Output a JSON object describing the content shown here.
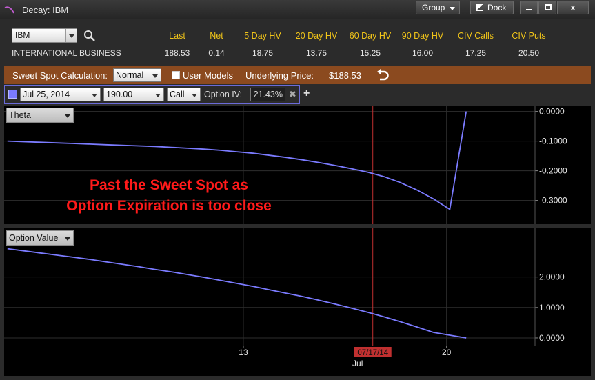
{
  "window": {
    "title": "Decay: IBM"
  },
  "toolbar": {
    "group_label": "Group",
    "dock_label": "Dock",
    "close_glyph": "x"
  },
  "quote": {
    "symbol": "IBM",
    "company": "INTERNATIONAL BUSINESS",
    "columns": [
      {
        "header": "Last",
        "value": "188.53"
      },
      {
        "header": "Net",
        "value": "0.14"
      },
      {
        "header": "5 Day HV",
        "value": "18.75"
      },
      {
        "header": "20 Day HV",
        "value": "13.75"
      },
      {
        "header": "60 Day HV",
        "value": "15.25"
      },
      {
        "header": "90 Day HV",
        "value": "16.00"
      },
      {
        "header": "CIV Calls",
        "value": "17.25"
      },
      {
        "header": "CIV Puts",
        "value": "20.50"
      }
    ]
  },
  "sweet_spot": {
    "label": "Sweet Spot Calculation:",
    "mode": "Normal",
    "user_models_label": "User Models",
    "underlying_label": "Underlying Price:",
    "underlying_value": "$188.53"
  },
  "option": {
    "expiration": "Jul 25, 2014",
    "strike": "190.00",
    "type": "Call",
    "iv_label": "Option IV:",
    "iv_value": "21.43%",
    "clear_glyph": "✖",
    "add_glyph": "+"
  },
  "annotation": [
    "Past the Sweet Spot as",
    "Option Expiration is too close"
  ],
  "colors": {
    "series": "#7b7bff",
    "marker": "#c03030",
    "annotation": "#ff1a1a",
    "sweet_bar": "#8b4a1f",
    "quote_header": "#f0c419"
  },
  "chart_data": [
    {
      "type": "line",
      "selector": "Theta",
      "ytick_labels": [
        "0.0000",
        "-0.1000",
        "-0.2000",
        "-0.3000"
      ],
      "ylim": [
        -0.38,
        0.02
      ],
      "x": [
        0,
        0.5,
        1,
        1.5,
        2,
        2.5,
        3,
        3.5,
        4,
        4.5,
        5,
        5.5,
        6,
        6.5,
        7,
        7.5,
        8,
        8.5,
        9,
        9.5,
        10,
        10.5,
        11,
        11.5,
        12,
        12.5,
        13,
        13.5,
        14
      ],
      "values": [
        -0.1,
        -0.102,
        -0.104,
        -0.106,
        -0.108,
        -0.11,
        -0.112,
        -0.114,
        -0.116,
        -0.118,
        -0.121,
        -0.124,
        -0.127,
        -0.131,
        -0.136,
        -0.141,
        -0.148,
        -0.155,
        -0.163,
        -0.172,
        -0.182,
        -0.193,
        -0.205,
        -0.22,
        -0.24,
        -0.265,
        -0.295,
        -0.33,
        0.0
      ]
    },
    {
      "type": "line",
      "selector": "Option Value",
      "ytick_labels": [
        "2.0000",
        "1.0000",
        "0.0000"
      ],
      "ylim": [
        -0.25,
        3.6
      ],
      "x": [
        0,
        0.5,
        1,
        1.5,
        2,
        2.5,
        3,
        3.5,
        4,
        4.5,
        5,
        5.5,
        6,
        6.5,
        7,
        7.5,
        8,
        8.5,
        9,
        9.5,
        10,
        10.5,
        11,
        11.5,
        12,
        12.5,
        13,
        13.5,
        14
      ],
      "values": [
        2.93,
        2.86,
        2.79,
        2.72,
        2.65,
        2.58,
        2.5,
        2.42,
        2.34,
        2.25,
        2.17,
        2.08,
        1.99,
        1.89,
        1.79,
        1.69,
        1.58,
        1.47,
        1.36,
        1.24,
        1.11,
        0.98,
        0.84,
        0.69,
        0.53,
        0.36,
        0.18,
        0.09,
        0.0
      ]
    }
  ],
  "x_axis": {
    "ticks": [
      {
        "label": "13",
        "x": 7.2
      },
      {
        "label": "20",
        "x": 13.4
      }
    ],
    "marker": {
      "label": "07/17/14",
      "x": 11.15
    },
    "month_label": "Jul",
    "xlim": [
      -0.1,
      16.1
    ]
  }
}
